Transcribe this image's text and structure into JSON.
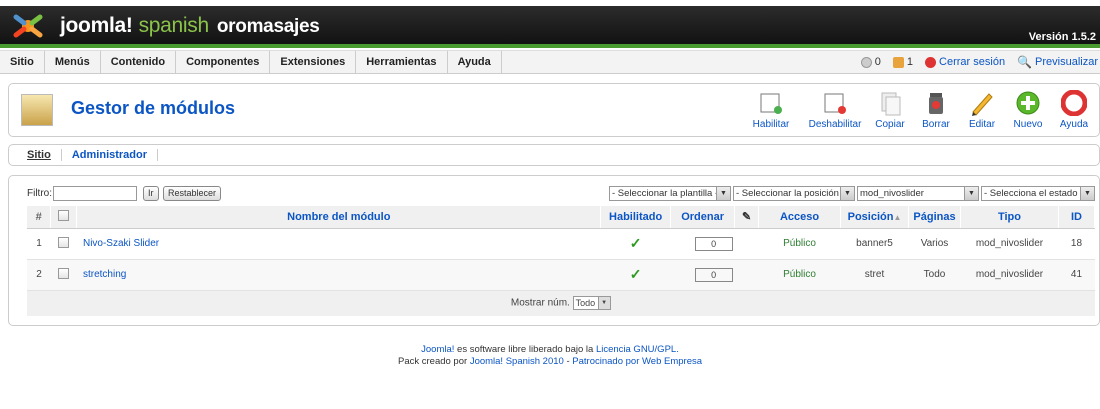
{
  "header": {
    "brand_name": "joomla!",
    "brand_sub": "spanish",
    "site_name": "oromasajes",
    "version": "Versión 1.5.2"
  },
  "menu": [
    "Sitio",
    "Menús",
    "Contenido",
    "Componentes",
    "Extensiones",
    "Herramientas",
    "Ayuda"
  ],
  "status": {
    "messages": "0",
    "users": "1",
    "logout": "Cerrar sesión",
    "preview": "Previsualizar"
  },
  "page": {
    "title": "Gestor de módulos"
  },
  "toolbar": [
    "Habilitar",
    "Deshabilitar",
    "Copiar",
    "Borrar",
    "Editar",
    "Nuevo",
    "Ayuda"
  ],
  "subnav": [
    "Sitio",
    "Administrador"
  ],
  "filter": {
    "label": "Filtro:",
    "value": "",
    "go": "Ir",
    "reset": "Restablecer",
    "template": "- Seleccionar la plantilla -",
    "position": "- Seleccionar la posición -",
    "type": "mod_nivoslider",
    "state": "- Selecciona el estado -"
  },
  "table": {
    "headers": [
      "#",
      "",
      "Nombre del módulo",
      "Habilitado",
      "Ordenar",
      "",
      "Acceso",
      "Posición",
      "Páginas",
      "Tipo",
      "ID"
    ],
    "rows": [
      {
        "num": "1",
        "name": "Nivo-Szaki Slider",
        "order": "0",
        "access": "Público",
        "position": "banner5",
        "pages": "Varios",
        "type": "mod_nivoslider",
        "id": "18"
      },
      {
        "num": "2",
        "name": "stretching",
        "order": "0",
        "access": "Público",
        "position": "stret",
        "pages": "Todo",
        "type": "mod_nivoslider",
        "id": "41"
      }
    ],
    "footer_label": "Mostrar núm.",
    "footer_value": "Todo"
  },
  "footer": {
    "l1_a": "Joomla!",
    "l1_b": " es software libre liberado bajo la ",
    "l1_c": "Licencia GNU/GPL.",
    "l2_a": "Pack creado por ",
    "l2_b": "Joomla! Spanish 2010",
    "l2_c": " - ",
    "l2_d": "Patrocinado por Web Empresa"
  },
  "colors": {
    "accent": "#0b55c4",
    "green": "#4a9b2f"
  }
}
